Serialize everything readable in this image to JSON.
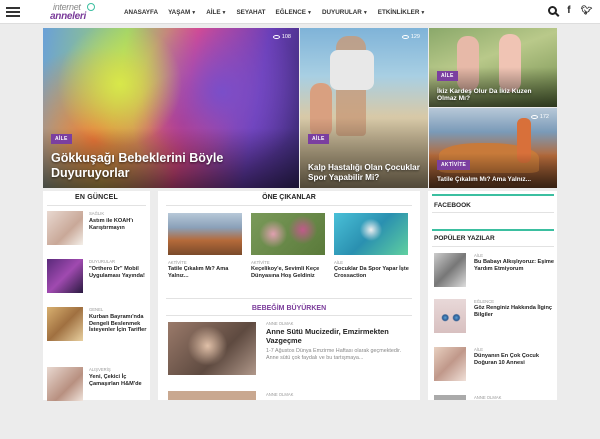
{
  "header": {
    "logo_line1": "internet",
    "logo_line2": "anneleri",
    "nav": [
      {
        "label": "ANASAYFA",
        "dropdown": false
      },
      {
        "label": "YAŞAM",
        "dropdown": true
      },
      {
        "label": "AİLE",
        "dropdown": true
      },
      {
        "label": "SEYAHAT",
        "dropdown": false
      },
      {
        "label": "EĞLENCE",
        "dropdown": true
      },
      {
        "label": "DUYURULAR",
        "dropdown": true
      },
      {
        "label": "ETKİNLİKLER",
        "dropdown": true
      }
    ],
    "icons": [
      "search-icon",
      "facebook-icon",
      "twitter-icon"
    ]
  },
  "hero": [
    {
      "badge": "AİLE",
      "title": "Gökkuşağı Bebeklerini Böyle Duyuruyorlar",
      "views": "108"
    },
    {
      "badge": "AİLE",
      "title": "Kalp Hastalığı Olan Çocuklar Spor Yapabilir Mi?",
      "views": "129"
    },
    {
      "badge": "AİLE",
      "title": "İkiz Kardeş Olur Da İkiz Kuzen Olmaz Mı?",
      "views": ""
    },
    {
      "badge": "AKTİVİTE",
      "title": "Tatile Çıkalım Mı? Ama Yalnız...",
      "views": "172"
    }
  ],
  "en_guncel": {
    "title": "EN GÜNCEL",
    "items": [
      {
        "category": "SAĞLIK",
        "title": "Astım ile KOAH'ı Karıştırmayın"
      },
      {
        "category": "DUYURULAR",
        "title": "\"Orthero Dr\" Mobil Uygulaması Yayında!"
      },
      {
        "category": "GENEL",
        "title": "Kurban Bayramı'nda Dengeli Beslenmek İsteyenler İçin Tarifler"
      },
      {
        "category": "ALIŞVERİŞ",
        "title": "Yeni, Çekici İç Çamaşırları H&M'de"
      }
    ]
  },
  "one_cikanlar": {
    "title": "ÖNE ÇIKANLAR",
    "cards": [
      {
        "category": "AKTİVİTE",
        "title": "Tatile Çıkalım Mı? Ama Yalnız..."
      },
      {
        "category": "AKTİVİTE",
        "title": "Keçelikoy'e, Sevimli Keçe Dünyasına Hoş Geldiniz"
      },
      {
        "category": "AİLE",
        "title": "Çocuklar Da Spor Yapar İşte Crossaction"
      }
    ]
  },
  "bebegim": {
    "title": "BEBEĞİM BÜYÜRKEN",
    "category": "ANNE OLMAK",
    "headline": "Anne Sütü Mucizedir, Emzirmekten Vazgeçme",
    "excerpt": "1-7 Ağustos Dünya Emzirme Haftası olarak geçmektedir. Anne sütü çok faydalı ve bu tartışmaya...",
    "category2": "ANNE OLMAK"
  },
  "sidebar": {
    "facebook_title": "FACEBOOK",
    "popular_title": "POPÜLER YAZILAR",
    "items": [
      {
        "category": "AİLE",
        "title": "Bu Babayı Alkışlıyoruz: Eşime Yardım Etmiyorum"
      },
      {
        "category": "EĞLENCE",
        "title": "Göz Renginiz Hakkında İlginç Bilgiler"
      },
      {
        "category": "AİLE",
        "title": "Dünyanın En Çok Çocuk Doğuran 10 Annesi"
      },
      {
        "category": "ANNE OLMAK",
        "title": ""
      }
    ]
  },
  "colors": {
    "brand_purple": "#7b3fa0",
    "accent_teal": "#3bbfa0"
  }
}
